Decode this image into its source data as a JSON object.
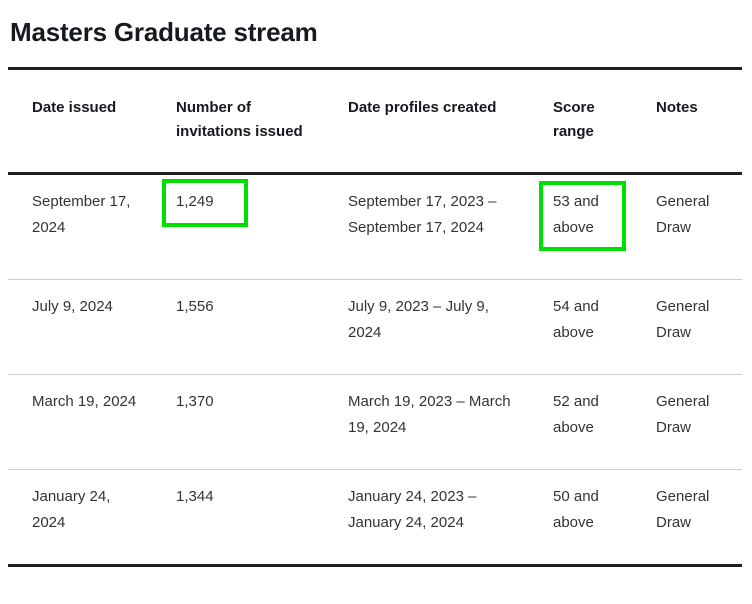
{
  "page": {
    "title": "Masters Graduate stream"
  },
  "table": {
    "columns": [
      {
        "key": "date_issued",
        "label": "Date issued"
      },
      {
        "key": "invitations",
        "label": "Number of invitations issued"
      },
      {
        "key": "profiles_date",
        "label": "Date profiles created"
      },
      {
        "key": "score_range",
        "label": "Score range"
      },
      {
        "key": "notes",
        "label": "Notes"
      }
    ],
    "rows": [
      {
        "date_issued": "September 17, 2024",
        "invitations": "1,249",
        "profiles_date": "September 17, 2023 – September 17, 2024",
        "score_range": "53 and above",
        "notes": "General Draw",
        "highlight_invitations": true,
        "highlight_score": true
      },
      {
        "date_issued": "July 9, 2024",
        "invitations": "1,556",
        "profiles_date": "July 9, 2023 – July 9, 2024",
        "score_range": "54 and above",
        "notes": "General Draw",
        "highlight_invitations": false,
        "highlight_score": false
      },
      {
        "date_issued": "March 19, 2024",
        "invitations": "1,370",
        "profiles_date": "March 19, 2023 – March 19, 2024",
        "score_range": "52 and above",
        "notes": "General Draw",
        "highlight_invitations": false,
        "highlight_score": false
      },
      {
        "date_issued": "January 24, 2024",
        "invitations": "1,344",
        "profiles_date": "January 24, 2023 – January 24, 2024",
        "score_range": "50 and above",
        "notes": "General Draw",
        "highlight_invitations": false,
        "highlight_score": false
      }
    ]
  },
  "colors": {
    "highlight_border": "#00e000",
    "rule_strong": "#1d1f21",
    "rule_light": "#cdcdcd",
    "heading_text": "#16191d",
    "body_text": "#333333"
  }
}
